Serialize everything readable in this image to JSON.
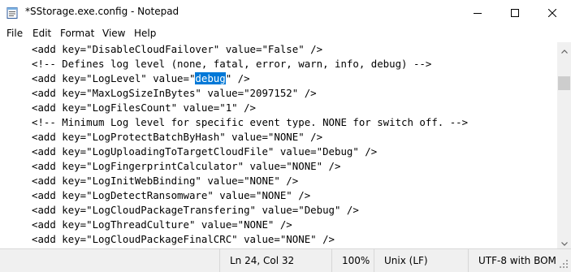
{
  "window": {
    "title": "*SStorage.exe.config - Notepad",
    "app_icon": "notepad-icon",
    "controls": {
      "minimize": "minimize-icon",
      "maximize": "maximize-icon",
      "close": "close-icon"
    }
  },
  "menu": {
    "items": [
      "File",
      "Edit",
      "Format",
      "View",
      "Help"
    ]
  },
  "editor": {
    "lines": [
      "<add key=\"DisableCloudFailover\" value=\"False\" />",
      "<!-- Defines log level (none, fatal, error, warn, info, debug) -->",
      "<add key=\"LogLevel\" value=\"",
      "<add key=\"MaxLogSizeInBytes\" value=\"2097152\" />",
      "<add key=\"LogFilesCount\" value=\"1\" />",
      "<!-- Minimum Log level for specific event type. NONE for switch off. -->",
      "<add key=\"LogProtectBatchByHash\" value=\"NONE\" />",
      "<add key=\"LogUploadingToTargetCloudFile\" value=\"Debug\" />",
      "<add key=\"LogFingerprintCalculator\" value=\"NONE\" />",
      "<add key=\"LogInitWebBinding\" value=\"NONE\" />",
      "<add key=\"LogDetectRansomware\" value=\"NONE\" />",
      "<add key=\"LogCloudPackageTransfering\" value=\"Debug\" />",
      "<add key=\"LogThreadCulture\" value=\"NONE\" />",
      "<add key=\"LogCloudPackageFinalCRC\" value=\"NONE\" />"
    ],
    "selected_text": "debug",
    "after_selection": "\" />",
    "selection_color": "#0078d7"
  },
  "status": {
    "position": "Ln 24, Col 32",
    "zoom": "100%",
    "line_ending": "Unix (LF)",
    "encoding": "UTF-8 with BOM"
  }
}
